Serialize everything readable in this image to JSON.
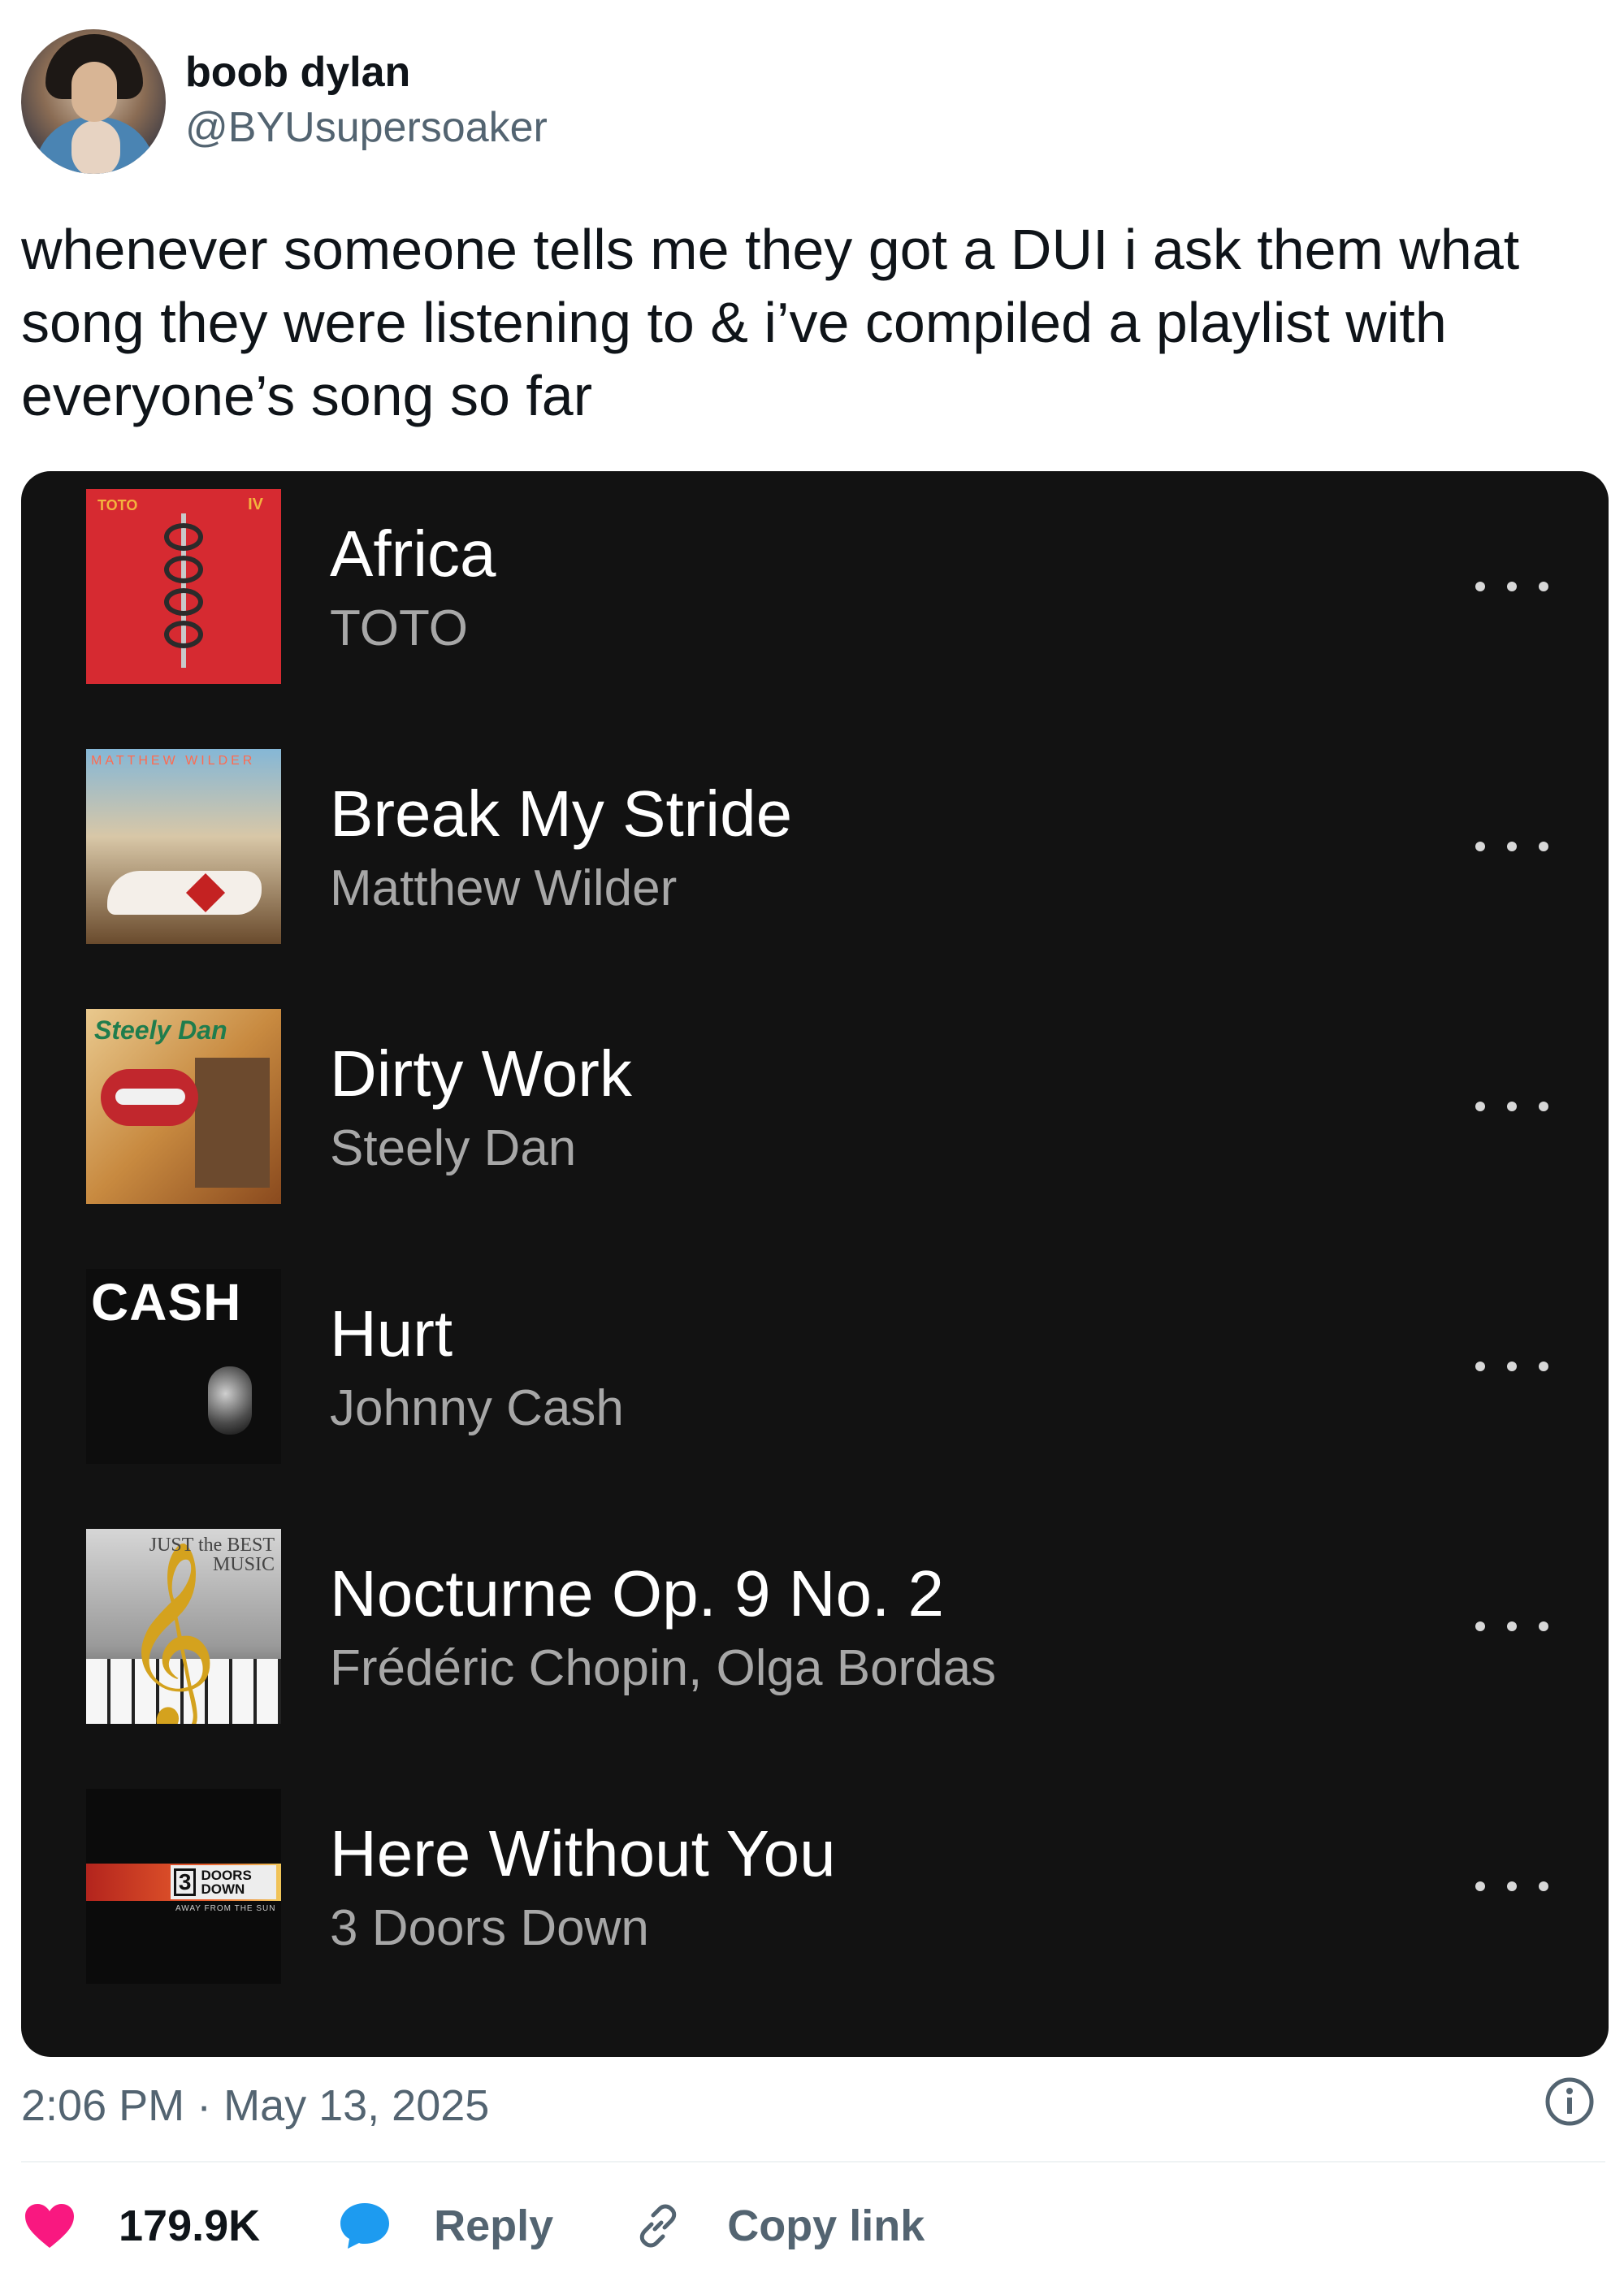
{
  "author": {
    "display_name": "boob dylan",
    "handle": "@BYUsupersoaker"
  },
  "tweet": {
    "text": "whenever someone tells me they got a DUI i ask them what song they were listening to & i’ve compiled a playlist with everyone’s song so far",
    "timestamp": "2:06 PM · May 13, 2025"
  },
  "playlist": {
    "tracks": [
      {
        "title": "Africa",
        "artist": "TOTO",
        "art": {
          "text1": "TOTO",
          "text2": "IV"
        }
      },
      {
        "title": "Break My Stride",
        "artist": "Matthew Wilder",
        "art": {
          "text1": "MATTHEW WILDER"
        }
      },
      {
        "title": "Dirty Work",
        "artist": "Steely Dan",
        "art": {
          "text1": "Steely Dan"
        }
      },
      {
        "title": "Hurt",
        "artist": "Johnny Cash",
        "art": {
          "text1": "CASH"
        }
      },
      {
        "title": "Nocturne Op. 9 No. 2",
        "artist": "Frédéric Chopin, Olga Bordas",
        "art": {
          "text1": "JUST the BEST MUSIC"
        }
      },
      {
        "title": "Here Without You",
        "artist": "3 Doors Down",
        "art": {
          "text1": "3",
          "text2": "DOORS DOWN",
          "text3": "AWAY FROM THE SUN"
        }
      }
    ]
  },
  "actions": {
    "like_count": "179.9K",
    "reply_label": "Reply",
    "copy_label": "Copy link"
  },
  "colors": {
    "like": "#f91880",
    "reply": "#1d9bf0",
    "card_bg": "#121212",
    "secondary_text": "#536471"
  },
  "icons": {
    "like": "heart-icon",
    "reply": "speech-bubble-icon",
    "copy": "link-icon",
    "info": "info-icon",
    "more": "more-horizontal-icon"
  }
}
